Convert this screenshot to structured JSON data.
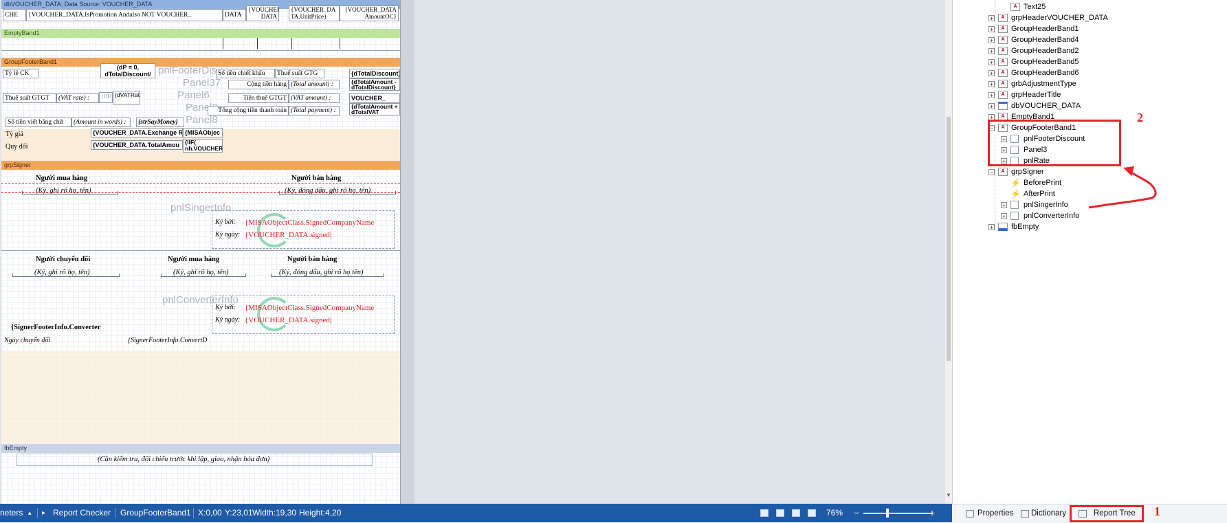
{
  "designer": {
    "bands": {
      "data": "dbVOUCHER_DATA; Data Source: VOUCHER_DATA",
      "empty": "EmptyBand1",
      "group_footer": "GroupFooterBand1",
      "signer": "grpSigner",
      "fb_empty": "fbEmpty"
    },
    "data_cells": {
      "che": "CHE",
      "promo": "{VOUCHER_DATA.IsPromotion Andalso NOT VOUCHER_",
      "data_short": "DATA",
      "voucher1": "{VOUCHER_ DATA",
      "voucher2": "{VOUCHER_DA TA.UnitPrice}",
      "voucher3": "{VOUCHER_DATA AmountOC}"
    },
    "footer": {
      "ty_le_ck": "Tỷ lệ CK",
      "dtotal_discount_top": "dTotalDiscount/",
      "dtotal_discount_top_cut": "(dP = 0,",
      "ghost_pnl_footer": "pnlFooterDis",
      "so_tien_ck": "Số tiền chiết khấu",
      "thue_suat_gtg": "Thuế suất GTG",
      "dtotal_discount_right": "{dTotalDiscount}",
      "ghost_panel37": "Panel37",
      "cong_tien_hang": "Cộng tiền hàng",
      "total_amount": "(Total amount) :",
      "dtotal_amount_minus": "{dTotalAmount - dTotalDiscount}",
      "thue_suat_gtgt": "Thuế suất GTGT",
      "vat_rate": "(VAT rate) :",
      "iif_short": "{IIF(",
      "dvat_rate": "{dVATRat",
      "ghost_panel6": "Panel6",
      "tien_thue": "Tiền thuế GTGT",
      "vat_amount": "(VAT amount) :",
      "voucher_right": "VOUCHER_",
      "ghost_panel8a": "Panel8",
      "tong_cong": "Tổng cộng tiền thanh toán",
      "total_payment": "(Total payment) :",
      "dtotal_amount_plus": "{dTotalAmount + dTotalVAT",
      "so_tien_chu": "Số tiền viết bằng chữ",
      "amount_words": "(Amount in words) :",
      "say_money": "{strSayMoney}",
      "ghost_panel8b": "Panel8",
      "ty_gia": "Tỷ giá",
      "exchange": "{VOUCHER_DATA.Exchange Rate} Class.",
      "misa_obj": "{MISAObjec",
      "quy_doi": "Quy đổi",
      "total_amou": "{VOUCHER_DATA.TotalAmou",
      "iif_voucher": "{IIF( nh.VOUCHER_"
    },
    "signer": {
      "nguoi_mua_hang": "Người mua hàng",
      "ky_ghi_ro": "(Ký, ghi rõ họ, tên)",
      "nguoi_ban_hang": "Người bán hàng",
      "ky_dong_dau": "(Ký, đóng dấu, ghi rõ họ, tên)",
      "ghost_pnl_singer": "pnlSingerInfo",
      "ky_boi": "Ký bởi:",
      "signed_company": "{MISAObjectClass.SignedCompanyName",
      "ky_ngay": "Ký ngày:",
      "signed_date": "{VOUCHER_DATA.signed|",
      "nguoi_chuyen_doi": "Người chuyển đổi",
      "ky_ghi_ro_2": "(Ký, ghi rõ họ, tên)",
      "nguoi_mua_hang_2": "Người mua hàng",
      "ky_ghi_ro_3": "(Ký, ghi rõ họ, tên)",
      "nguoi_ban_hang_2": "Người bán hàng",
      "ky_dong_dau_2": "(Ký, đóng dấu, ghi rõ họ tên)",
      "ghost_pnl_converter": "pnlConverterInfo",
      "ky_boi_2": "Ký bởi:",
      "signed_company_2": "{MISAObjectClass.SignedCompanyName",
      "ky_ngay_2": "Ký ngày:",
      "signed_date_2": "{VOUCHER_DATA.signed|",
      "converter_name": "{SignerFooterInfo.Converter",
      "ngay_chuyen_doi": "Ngày chuyển đổi",
      "converter_date": "{SignerFooterInfo.ConvertD"
    },
    "fb_empty_text": "(Cần kiểm tra, đối chiếu trước khi lập, giao, nhận hóa đơn)"
  },
  "tree": {
    "items": [
      {
        "label": "Text25",
        "icon": "text-icon"
      },
      {
        "label": "grpHeaderVOUCHER_DATA",
        "icon": "band-icon"
      },
      {
        "label": "GroupHeaderBand1",
        "icon": "band-icon"
      },
      {
        "label": "GroupHeaderBand4",
        "icon": "band-icon"
      },
      {
        "label": "GroupHeaderBand2",
        "icon": "band-icon"
      },
      {
        "label": "GroupHeaderBand5",
        "icon": "band-icon"
      },
      {
        "label": "GroupHeaderBand6",
        "icon": "band-icon"
      },
      {
        "label": "grbAdjustmentType",
        "icon": "band-icon"
      },
      {
        "label": "grpHeaderTitle",
        "icon": "band-icon"
      },
      {
        "label": "dbVOUCHER_DATA",
        "icon": "databand-icon"
      },
      {
        "label": "EmptyBand1",
        "icon": "band-icon"
      },
      {
        "label": "GroupFooterBand1",
        "icon": "band-icon"
      },
      {
        "label": "pnlFooterDiscount",
        "icon": "panel-icon"
      },
      {
        "label": "Panel3",
        "icon": "panel-icon"
      },
      {
        "label": "pnlRate",
        "icon": "panel-icon"
      },
      {
        "label": "grpSigner",
        "icon": "band-icon"
      },
      {
        "label": "BeforePrint",
        "icon": "event-icon"
      },
      {
        "label": "AfterPrint",
        "icon": "event-icon"
      },
      {
        "label": "pnlSingerInfo",
        "icon": "panel-icon"
      },
      {
        "label": "pnlConverterInfo",
        "icon": "panel-icon"
      },
      {
        "label": "fbEmpty",
        "icon": "footer-band-icon"
      }
    ],
    "annotation_2": "2"
  },
  "status": {
    "units": "neters",
    "report_checker": "Report Checker",
    "selected": "GroupFooterBand1",
    "x": "X:0,00",
    "y": "Y:23,01",
    "width": "Width:19,30",
    "height": "Height:4,20",
    "zoom": "76%"
  },
  "tabs": {
    "properties": "Properties",
    "dictionary": "Dictionary",
    "report_tree": "Report Tree",
    "annotation_1": "1"
  },
  "colors": {
    "statusbar": "#1f5aa6",
    "annotation": "#e8232b",
    "band_data": "#8fb1e0",
    "band_empty": "#bde69c",
    "band_footer": "#f2a65a"
  }
}
